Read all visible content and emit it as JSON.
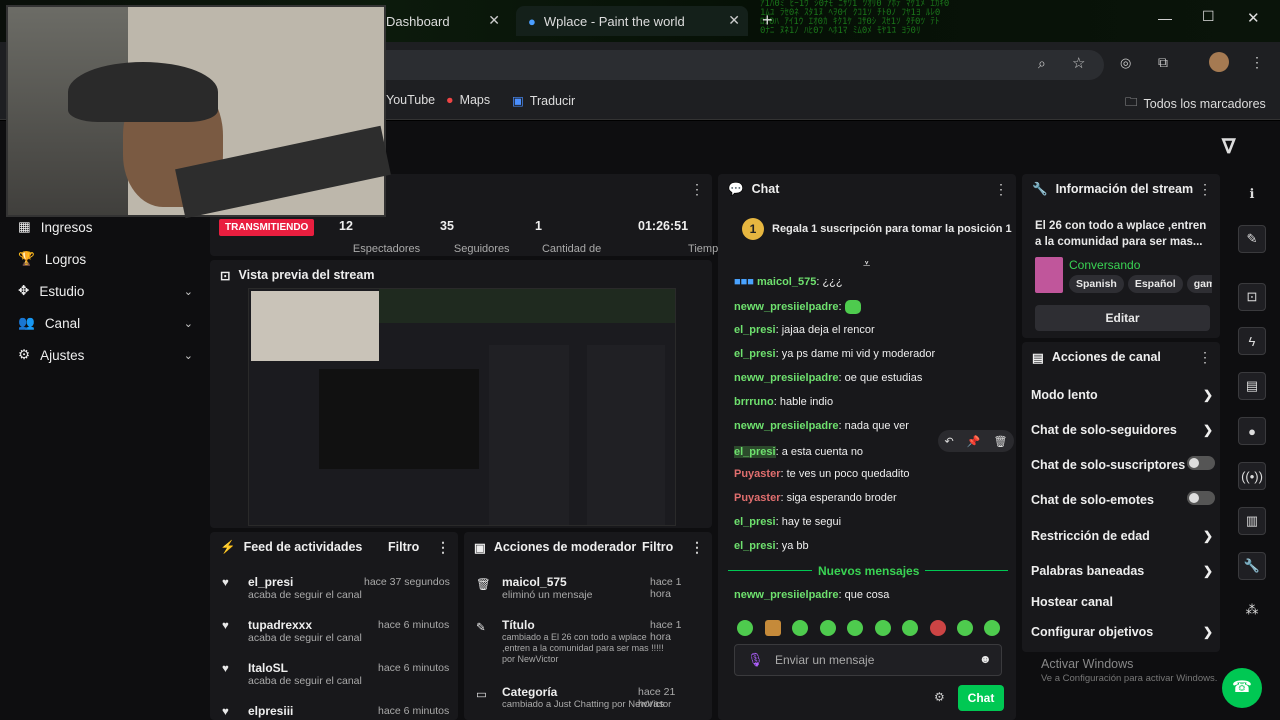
{
  "tabs": [
    {
      "label": "Dashboard"
    },
    {
      "label": "Wplace - Paint the world"
    }
  ],
  "bookmarks": {
    "youtube": "YouTube",
    "maps": "Maps",
    "translate": "Traducir",
    "all": "Todos los marcadores"
  },
  "sidebar": {
    "items": [
      {
        "label": "Ingresos"
      },
      {
        "label": "Logros"
      },
      {
        "label": "Estudio"
      },
      {
        "label": "Canal"
      },
      {
        "label": "Ajustes"
      }
    ]
  },
  "stats": {
    "status": "TRANSMITIENDO",
    "viewers": "12",
    "viewers_label": "Espectadores",
    "followers": "35",
    "followers_label": "Seguidores",
    "count": "1",
    "count_label": "Cantidad de",
    "time": "01:26:51",
    "time_label": "Tiempo en"
  },
  "preview": {
    "title": "Vista previa del stream"
  },
  "chat": {
    "title": "Chat",
    "gift_count": "1",
    "gift_text": "Regala 1 suscripción para tomar la posición 1",
    "messages": [
      {
        "user": "maicol_575",
        "text": " ¿¿¿"
      },
      {
        "user": "neww_presiielpadre",
        "text": ""
      },
      {
        "user": "el_presi",
        "text": " jajaa deja el rencor"
      },
      {
        "user": "el_presi",
        "text": " ya ps dame mi vid y moderador"
      },
      {
        "user": "neww_presiielpadre",
        "text": " oe que estudias"
      },
      {
        "user": "brrruno",
        "text": " hable indio"
      },
      {
        "user": "neww_presiielpadre",
        "text": " nada que ver"
      },
      {
        "user": "el_presi",
        "text": " a esta cuenta no"
      },
      {
        "user": "Puyaster",
        "text": " te ves un poco quedadito"
      },
      {
        "user": "Puyaster",
        "text": " siga esperando broder"
      },
      {
        "user": "el_presi",
        "text": " hay te segui"
      },
      {
        "user": "el_presi",
        "text": " ya bb"
      }
    ],
    "new_messages": "Nuevos mensajes",
    "last": {
      "user": "neww_presiielpadre",
      "text": " que cosa"
    },
    "input_placeholder": "Enviar un mensaje",
    "send": "Chat"
  },
  "stream_info": {
    "title": "Información del stream",
    "description": "El 26 con todo a wplace ,entren a la comunidad para ser mas...",
    "category": "Conversando",
    "tags": [
      "Spanish",
      "Español",
      "gami"
    ],
    "edit": "Editar"
  },
  "channel_actions": {
    "title": "Acciones de canal",
    "items": [
      "Modo lento",
      "Chat de solo-seguidores",
      "Chat de solo-suscriptores",
      "Chat de solo-emotes",
      "Restricción de edad",
      "Palabras baneadas",
      "Hostear canal",
      "Configurar objetivos"
    ]
  },
  "activity": {
    "title": "Feed de actividades",
    "filter": "Filtro",
    "items": [
      {
        "user": "el_presi",
        "action": "acaba de seguir el canal",
        "time": "hace 37 segundos"
      },
      {
        "user": "tupadrexxx",
        "action": "acaba de seguir el canal",
        "time": "hace 6 minutos"
      },
      {
        "user": "ItaloSL",
        "action": "acaba de seguir el canal",
        "time": "hace 6 minutos"
      },
      {
        "user": "elpresiii",
        "action": "",
        "time": "hace 6 minutos"
      }
    ]
  },
  "mod": {
    "title": "Acciones de moderador",
    "filter": "Filtro",
    "items": [
      {
        "title": "maicol_575",
        "detail": "eliminó un mensaje",
        "time": "hace 1 hora"
      },
      {
        "title": "Título",
        "detail": "cambiado a El 26 con todo a wplace ,entren a la comunidad para ser mas !!!!! por NewVictor",
        "time": "hace 1 hora"
      },
      {
        "title": "Categoría",
        "detail": "cambiado a Just Chatting por NewVictor",
        "time": "hace 21 horas"
      }
    ]
  },
  "watermark": {
    "line1": "Activar Windows",
    "line2": "Ve a Configuración para activar Windows."
  },
  "colors": {
    "accent": "#00c853",
    "bg": "#0e0e10",
    "panel": "#18181b"
  }
}
